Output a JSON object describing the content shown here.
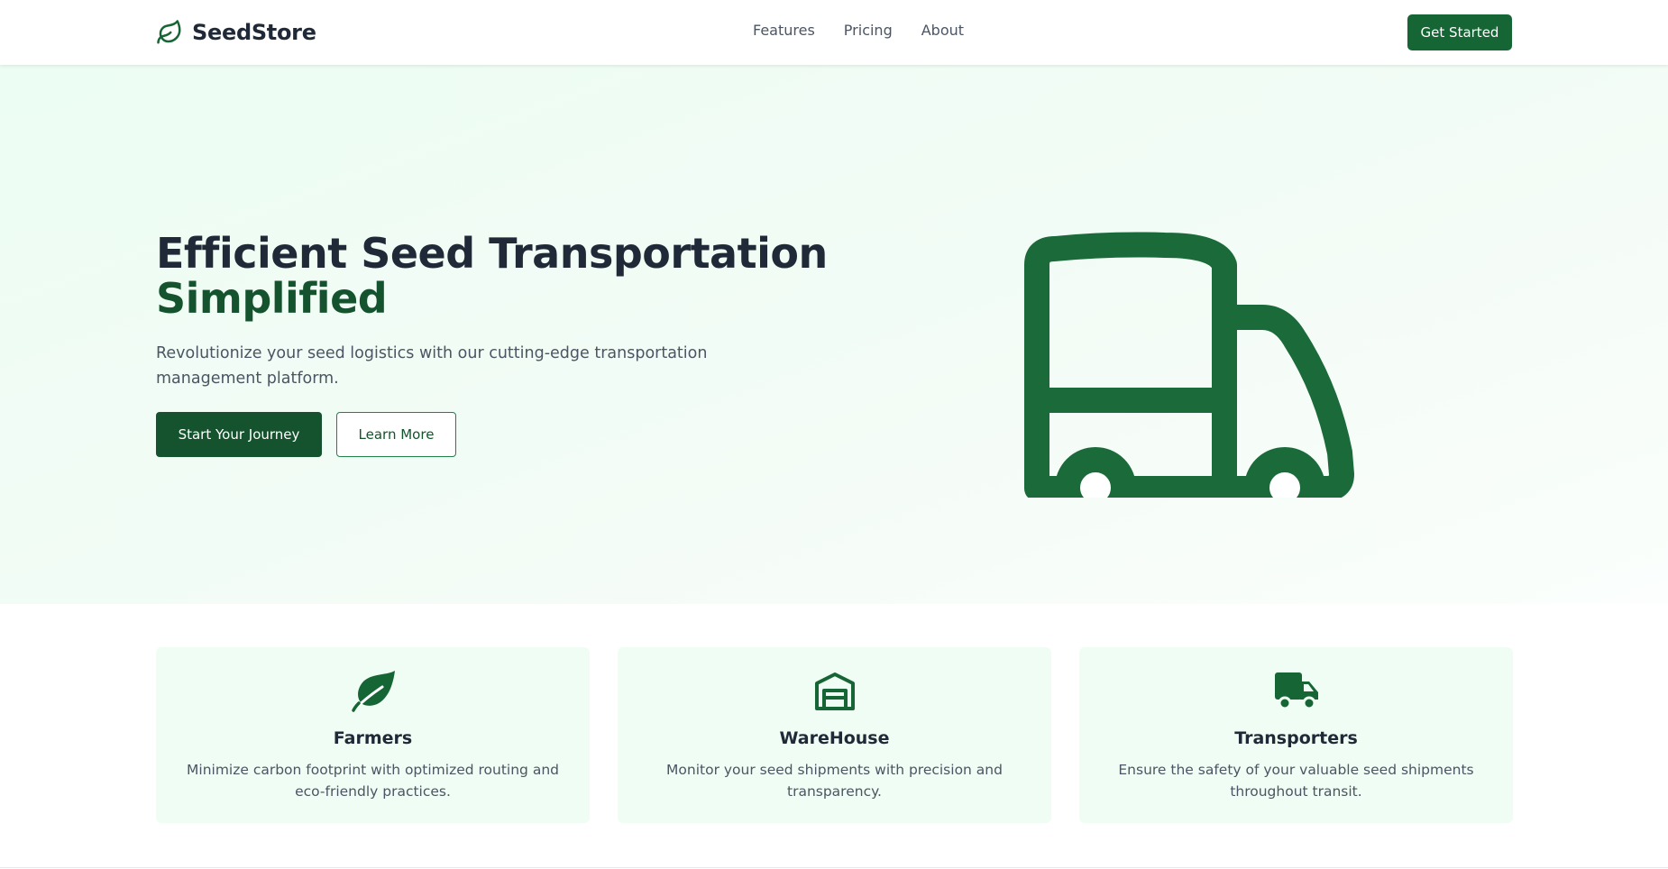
{
  "brand": {
    "name": "SeedStore",
    "icon": "leaf-icon"
  },
  "nav": {
    "links": [
      {
        "label": "Features"
      },
      {
        "label": "Pricing"
      },
      {
        "label": "About"
      }
    ],
    "cta_label": "Get Started"
  },
  "hero": {
    "title_line1": "Efficient Seed Transportation",
    "title_line2": "Simplified",
    "subtitle": "Revolutionize your seed logistics with our cutting-edge transportation management platform.",
    "primary_button": "Start Your Journey",
    "secondary_button": "Learn More",
    "illustration_icon": "truck-icon"
  },
  "features": [
    {
      "icon": "leaf-icon",
      "title": "Farmers",
      "description": "Minimize carbon footprint with optimized routing and eco-friendly practices."
    },
    {
      "icon": "warehouse-icon",
      "title": "WareHouse",
      "description": "Monitor your seed shipments with precision and transparency."
    },
    {
      "icon": "truck-icon",
      "title": "Transporters",
      "description": "Ensure the safety of your valuable seed shipments throughout transit."
    }
  ],
  "colors": {
    "brand_green": "#166534",
    "dark_green": "#14532d",
    "hero_bg": "#ecfdf3",
    "card_bg": "#f0fdf4",
    "text_dark": "#1f2937",
    "text_muted": "#4b5563"
  }
}
